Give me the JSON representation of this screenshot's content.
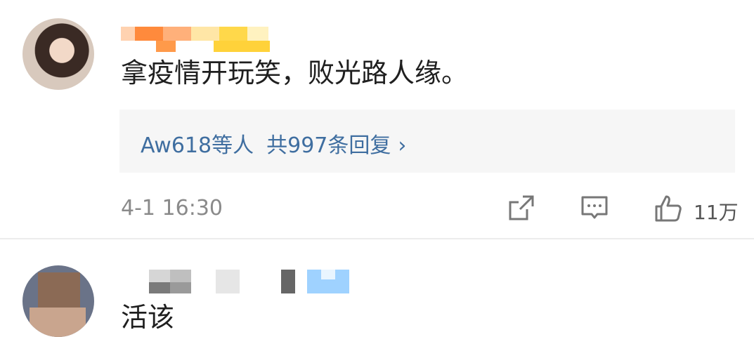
{
  "comments": [
    {
      "text": "拿疫情开玩笑，败光路人缘。",
      "reply_preview": {
        "users": "Aw618等人",
        "count_label": "共997条回复",
        "chevron": "›"
      },
      "timestamp": "4-1 16:30",
      "likes": "11万",
      "actions": [
        "share-icon",
        "comment-icon",
        "like-icon"
      ]
    },
    {
      "text": "活该"
    }
  ],
  "colors": {
    "link": "#3f6ea0",
    "meta": "#8a8a8a",
    "reply_bg": "#f6f6f6"
  }
}
